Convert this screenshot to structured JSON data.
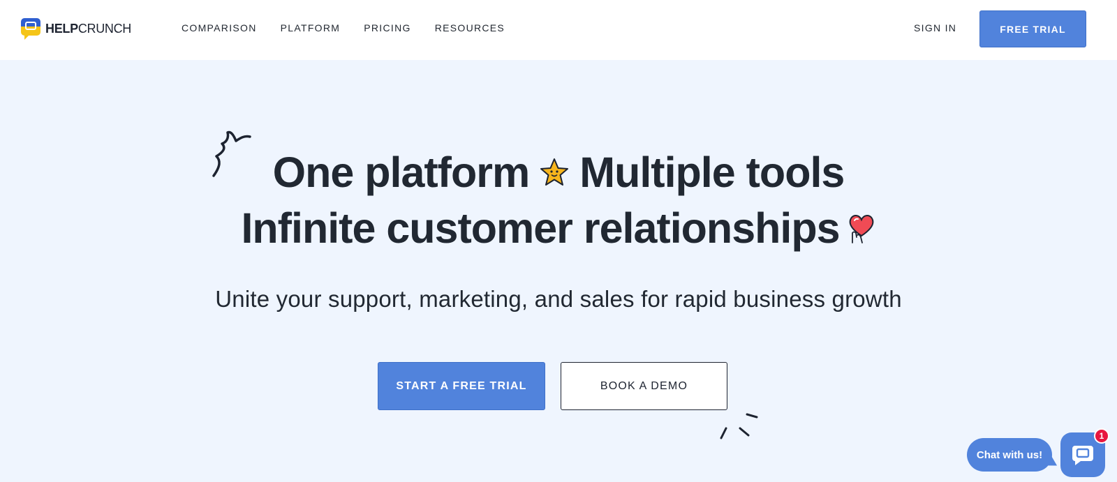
{
  "header": {
    "logo": {
      "bold": "HELP",
      "regular": "CRUNCH"
    },
    "nav": [
      "COMPARISON",
      "PLATFORM",
      "PRICING",
      "RESOURCES"
    ],
    "sign_in": "SIGN IN",
    "free_trial": "FREE TRIAL"
  },
  "hero": {
    "line1_a": "One platform",
    "line1_b": "Multiple tools",
    "line2": "Infinite customer relationships",
    "subtitle": "Unite your support, marketing, and sales for rapid business growth",
    "primary_cta": "START A FREE TRIAL",
    "secondary_cta": "BOOK A DEMO"
  },
  "chat": {
    "bubble": "Chat with us!",
    "badge": "1"
  },
  "colors": {
    "accent": "#5183dc",
    "background": "#eff5fe",
    "text": "#212832",
    "badge": "#e8163f"
  },
  "icons": [
    "helpcrunch-logo-icon",
    "squiggle-icon",
    "star-face-icon",
    "heart-hands-icon",
    "sparks-icon",
    "chat-icon"
  ]
}
